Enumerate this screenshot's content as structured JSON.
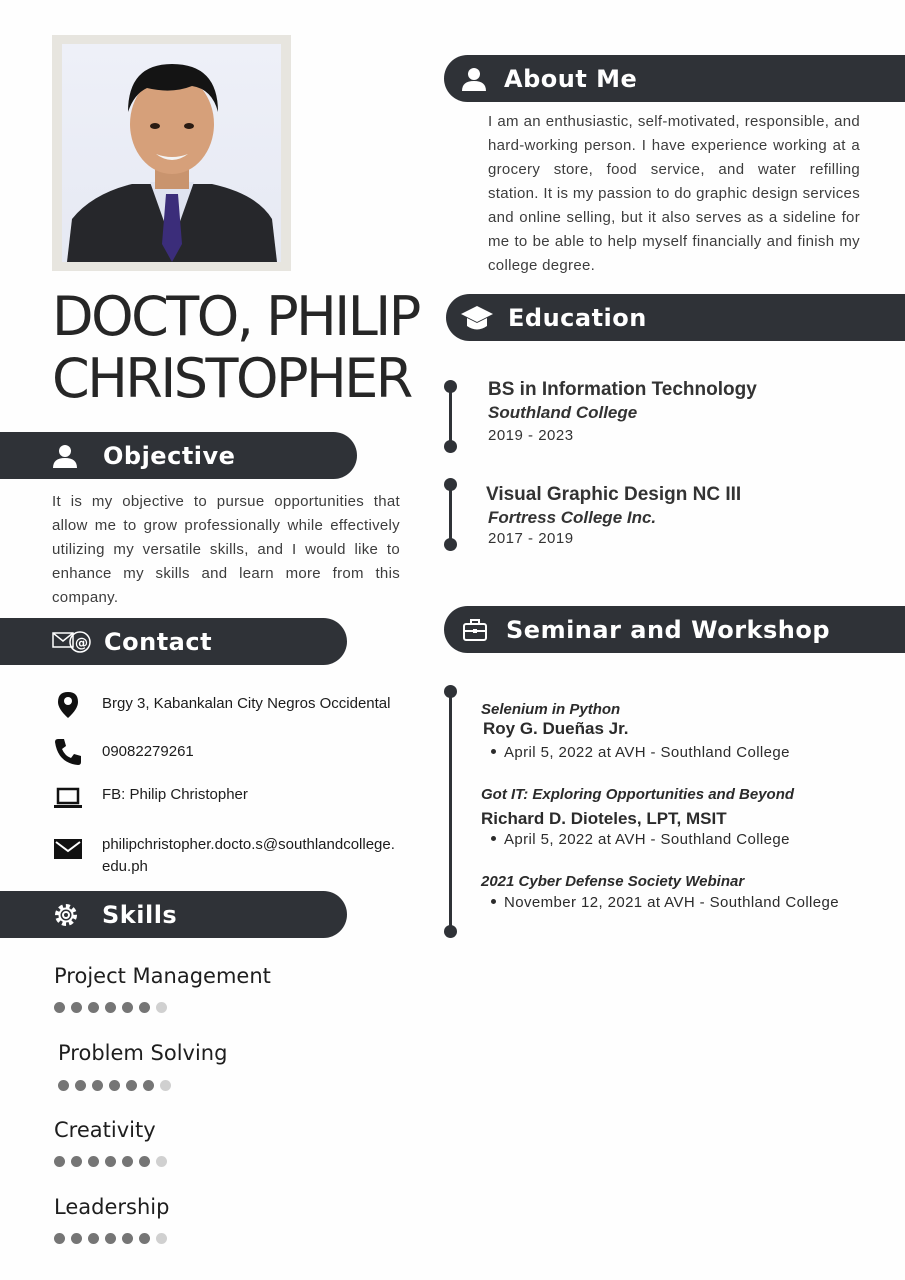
{
  "name": {
    "line1": "DOCTO, PHILIP",
    "line2": "CHRISTOPHER"
  },
  "about": {
    "title": "About Me",
    "text": "I am an enthusiastic, self-motivated, responsible, and hard-working person. I have experience working at a grocery store, food service, and water refilling station. It is my passion to do graphic design services and online selling, but it also serves as a sideline for me to be able to help myself financially and finish my college degree."
  },
  "objective": {
    "title": "Objective",
    "text": "It is my objective to pursue opportunities that allow me to grow professionally while effectively utilizing my versatile skills, and I would like to enhance my skills and learn more from this company."
  },
  "contact": {
    "title": "Contact",
    "address": "Brgy 3, Kabankalan City Negros Occidental",
    "phone": "09082279261",
    "facebook": "FB: Philip Christopher",
    "email": "philipchristopher.docto.s@southlandcollege.edu.ph"
  },
  "skills": {
    "title": "Skills",
    "items": [
      {
        "name": "Project Management",
        "level": 6,
        "max": 7
      },
      {
        "name": "Problem Solving",
        "level": 6,
        "max": 7
      },
      {
        "name": "Creativity",
        "level": 6,
        "max": 7
      },
      {
        "name": "Leadership",
        "level": 6,
        "max": 7
      }
    ]
  },
  "education": {
    "title": "Education",
    "items": [
      {
        "degree": "BS in Information Technology",
        "school": "Southland College",
        "years": "2019 - 2023"
      },
      {
        "degree": "Visual Graphic Design NC III",
        "school": "Fortress College Inc.",
        "years": "2017 - 2019"
      }
    ]
  },
  "seminars": {
    "title": "Seminar and Workshop",
    "items": [
      {
        "title": "Selenium in Python",
        "speaker": "Roy G. Dueñas Jr.",
        "date": "April 5, 2022 at AVH - Southland College"
      },
      {
        "title": "Got IT: Exploring Opportunities and Beyond",
        "speaker": "Richard D. Dioteles, LPT, MSIT",
        "date": "April 5, 2022 at AVH - Southland College"
      },
      {
        "title": "2021 Cyber Defense Society Webinar",
        "speaker": "",
        "date": "November 12, 2021 at AVH - Southland College"
      }
    ]
  },
  "colors": {
    "header_bg": "#2f3237",
    "dot_on": "#757575",
    "dot_off": "#d0d0d0"
  }
}
